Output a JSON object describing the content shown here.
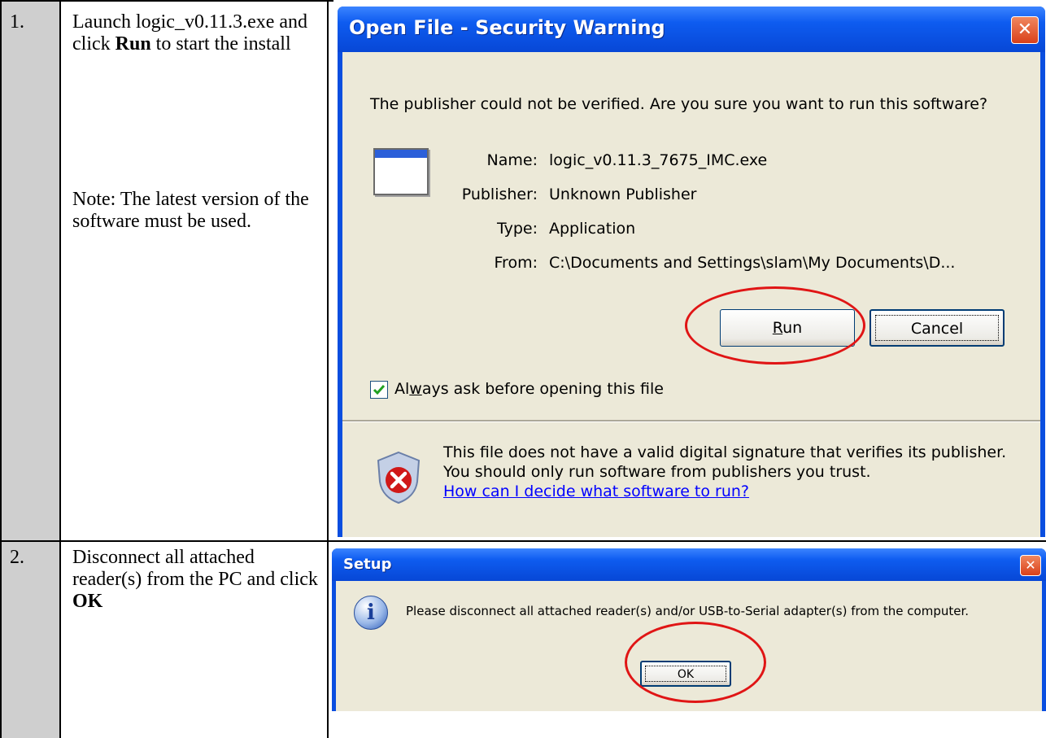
{
  "steps": [
    {
      "number": "1.",
      "text_before": "Launch logic_v0.11.3.exe and click ",
      "bold": "Run",
      "text_after": " to start the install",
      "note": "Note: The latest version of the software must be used."
    },
    {
      "number": "2.",
      "text_before": "Disconnect all attached reader(s) from the PC and click ",
      "bold": "OK",
      "text_after": ""
    }
  ],
  "security_dialog": {
    "title": "Open File - Security Warning",
    "close_glyph": "✕",
    "question": "The publisher could not be verified.  Are you sure you want to run this software?",
    "fields": [
      {
        "label": "Name:",
        "value": "logic_v0.11.3_7675_IMC.exe"
      },
      {
        "label": "Publisher:",
        "value": "Unknown Publisher"
      },
      {
        "label": "Type:",
        "value": "Application"
      },
      {
        "label": "From:",
        "value": "C:\\Documents and Settings\\slam\\My Documents\\D..."
      }
    ],
    "run_label_mnemonic": "R",
    "run_label_rest": "un",
    "cancel_label": "Cancel",
    "checkbox_pre": "Al",
    "checkbox_mnemonic": "w",
    "checkbox_post": "ays ask before opening this file",
    "checkbox_checked": true,
    "warning_text": "This file does not have a valid digital signature that verifies its publisher.  You should only run software from publishers you trust.",
    "help_link": "How can I decide what software to run?"
  },
  "setup_dialog": {
    "title": "Setup",
    "close_glyph": "✕",
    "info_glyph": "i",
    "message": "Please disconnect all attached reader(s) and/or USB-to-Serial adapter(s) from the computer.",
    "ok_label": "OK"
  },
  "colors": {
    "xp_blue": "#0a4ee0",
    "dialog_face": "#ece9d8",
    "highlight_ring": "#e01515",
    "link": "#0000ff"
  }
}
